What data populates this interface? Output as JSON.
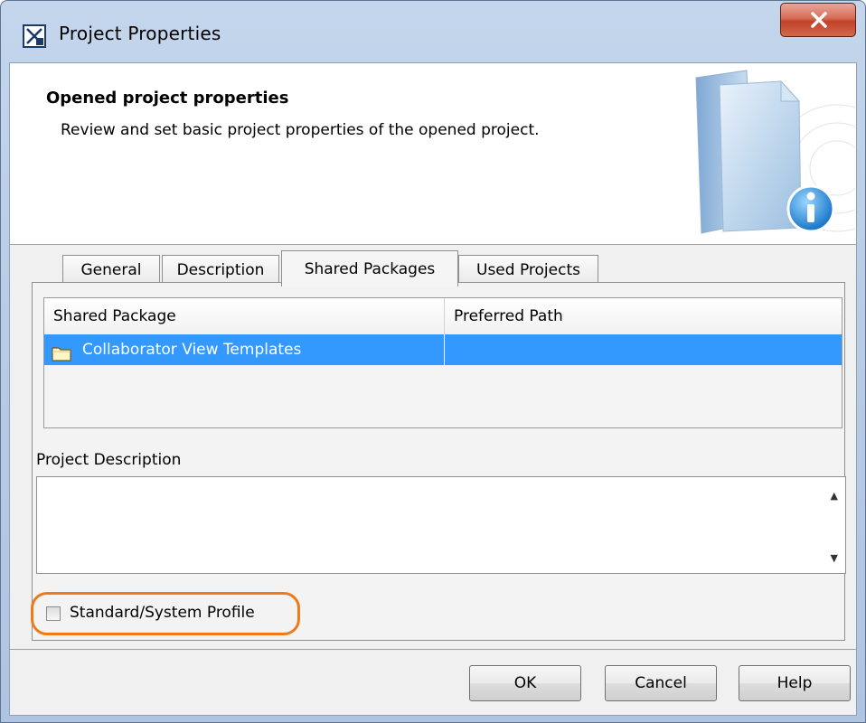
{
  "window": {
    "title": "Project Properties"
  },
  "header": {
    "title": "Opened project properties",
    "subtitle": "Review and set basic project properties of the opened project."
  },
  "tabs": [
    {
      "label": "General",
      "active": false
    },
    {
      "label": "Description",
      "active": false
    },
    {
      "label": "Shared Packages",
      "active": true
    },
    {
      "label": "Used Projects",
      "active": false
    }
  ],
  "shared_packages_table": {
    "columns": [
      "Shared Package",
      "Preferred Path"
    ],
    "rows": [
      {
        "package": "Collaborator View Templates",
        "preferred_path": "",
        "selected": true
      }
    ]
  },
  "project_description": {
    "label": "Project Description",
    "value": ""
  },
  "standard_profile": {
    "label": "Standard/System Profile",
    "checked": false
  },
  "buttons": {
    "ok": "OK",
    "cancel": "Cancel",
    "help": "Help"
  },
  "colors": {
    "selection": "#3399ff",
    "highlight": "#f07a1a",
    "close_button": "#c2412a"
  },
  "icons": {
    "app": "project-properties-icon",
    "close": "close-icon",
    "header_art": "document-info-icon",
    "row": "folder-icon"
  }
}
